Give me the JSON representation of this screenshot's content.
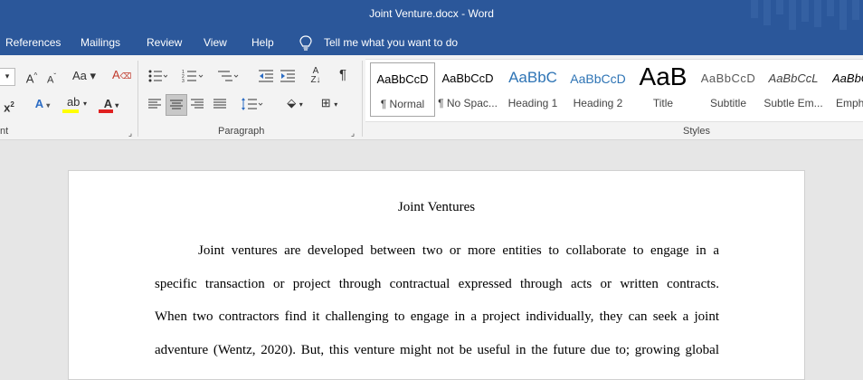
{
  "window": {
    "title": "Joint Venture.docx  -  Word"
  },
  "menu": {
    "tabs": [
      "References",
      "Mailings",
      "Review",
      "View",
      "Help"
    ],
    "tell_me": "Tell me what you want to do"
  },
  "ribbon": {
    "font_group_label": "nt",
    "paragraph_group_label": "Paragraph",
    "styles_group_label": "Styles",
    "styles": [
      {
        "preview": "AaBbCcD",
        "name": "¶ Normal",
        "color": "#000000"
      },
      {
        "preview": "AaBbCcD",
        "name": "¶ No Spac...",
        "color": "#000000"
      },
      {
        "preview": "AaBbC",
        "name": "Heading 1",
        "color": "#2e74b5"
      },
      {
        "preview": "AaBbCcD",
        "name": "Heading 2",
        "color": "#2e74b5"
      },
      {
        "preview": "AaB",
        "name": "Title",
        "color": "#000000"
      },
      {
        "preview": "AaBbCcD",
        "name": "Subtitle",
        "color": "#595959"
      },
      {
        "preview": "AaBbCcL",
        "name": "Subtle Em...",
        "color": "#404040"
      },
      {
        "preview": "AaBbC",
        "name": "Emph",
        "color": "#000000"
      }
    ]
  },
  "document": {
    "title": "Joint Ventures",
    "lines": [
      "Joint ventures are developed between two or more entities to collaborate to engage in a",
      "specific transaction or project through contractual expressed through acts or written contracts.",
      "When two contractors find it challenging to engage in a project individually, they can seek a joint",
      "adventure (Wentz, 2020). But, this venture might not be useful in the future due to; growing global"
    ]
  }
}
